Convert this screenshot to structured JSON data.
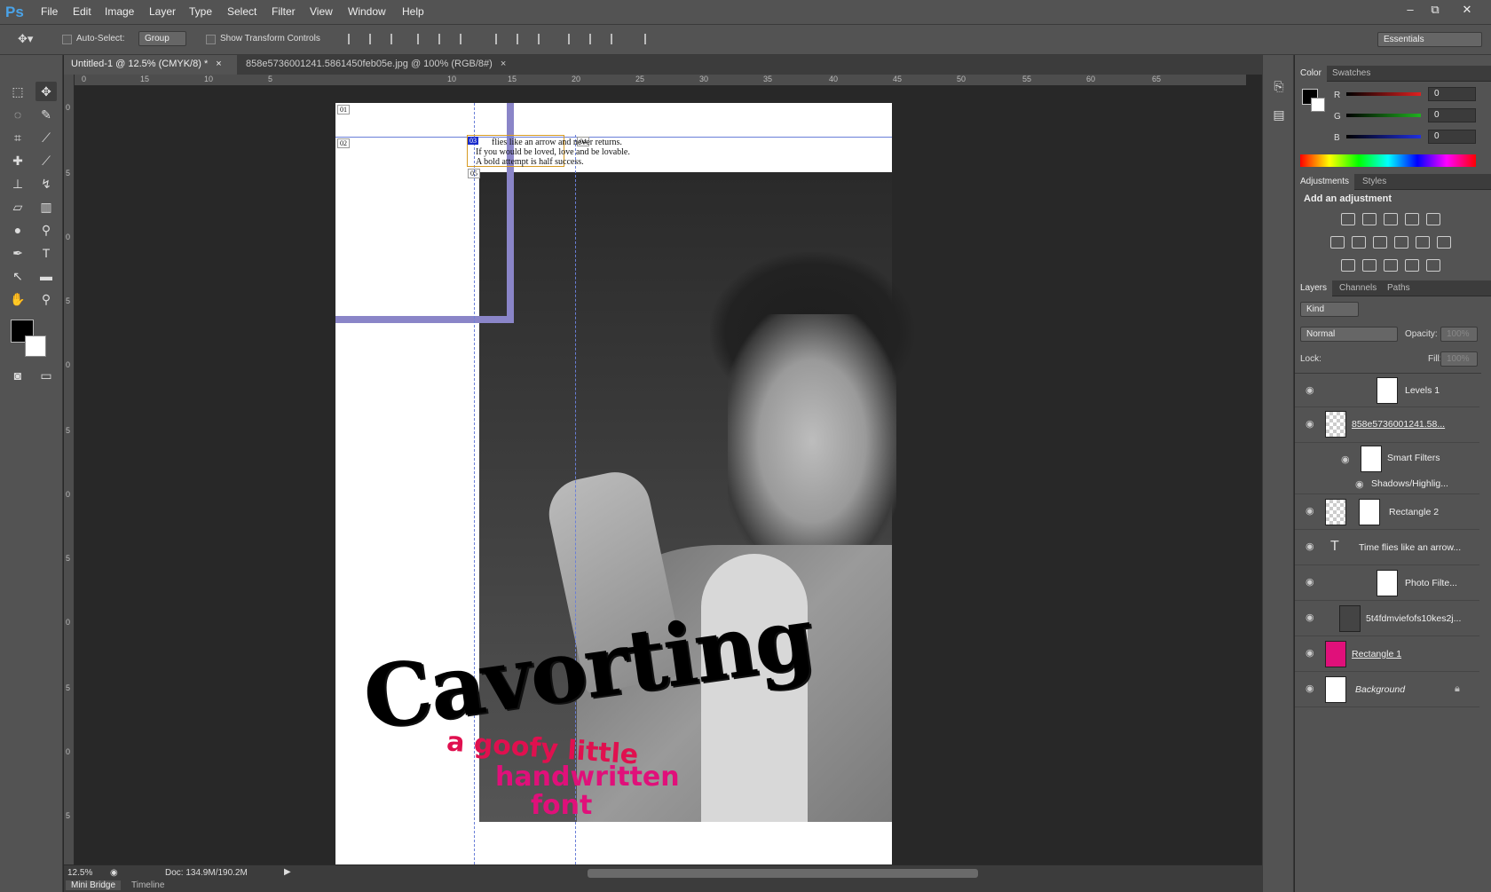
{
  "app": {
    "logo": "Ps"
  },
  "menu": [
    "File",
    "Edit",
    "Image",
    "Layer",
    "Type",
    "Select",
    "Filter",
    "View",
    "Window",
    "Help"
  ],
  "window_controls": [
    "–",
    "⧉",
    "✕"
  ],
  "options": {
    "auto_select_label": "Auto-Select:",
    "auto_select_value": "Group",
    "transform_label": "Show Transform Controls",
    "workspace": "Essentials"
  },
  "doc_tabs": [
    {
      "label": "Untitled-1 @ 12.5% (CMYK/8) *",
      "close": "×"
    },
    {
      "label": "858e5736001241.5861450feb05e.jpg @ 100% (RGB/8#)",
      "close": "×"
    }
  ],
  "ruler_h": [
    "0",
    "15",
    "10",
    "5",
    "10",
    "15",
    "20",
    "25",
    "30",
    "35",
    "40",
    "45",
    "50",
    "55",
    "60",
    "65"
  ],
  "ruler_v": [
    "0",
    "5",
    "0",
    "5",
    "0",
    "5",
    "0",
    "5",
    "0",
    "5",
    "0",
    "5",
    "0",
    "5",
    "0",
    "5"
  ],
  "canvas": {
    "slice_labels": [
      "01",
      "02",
      "03",
      "04",
      "05"
    ],
    "text_lines": [
      "flies like an arrow and never returns.",
      "If you would be loved, love and be lovable.",
      "A bold attempt is half success."
    ],
    "title_art": "Cavorting",
    "tagline": [
      "a goofy little",
      "handwritten",
      "font"
    ]
  },
  "status": {
    "zoom": "12.5%",
    "doc": "Doc: 134.9M/190.2M"
  },
  "bottom_tabs": [
    "Mini Bridge",
    "Timeline"
  ],
  "color_panel": {
    "tabs": [
      "Color",
      "Swatches"
    ],
    "channels": [
      {
        "name": "R",
        "value": "0",
        "color": "#e02020"
      },
      {
        "name": "G",
        "value": "0",
        "color": "#20b020"
      },
      {
        "name": "B",
        "value": "0",
        "color": "#2030e0"
      }
    ]
  },
  "adjust_panel": {
    "tabs": [
      "Adjustments",
      "Styles"
    ],
    "heading": "Add an adjustment"
  },
  "layers_panel": {
    "tabs": [
      "Layers",
      "Channels",
      "Paths"
    ],
    "kind": "Kind",
    "blend": "Normal",
    "opacity_label": "Opacity:",
    "opacity_value": "100%",
    "lock_label": "Lock:",
    "fill_label": "Fill:",
    "fill_value": "100%",
    "layers": [
      {
        "name": "Levels 1",
        "type": "adjust"
      },
      {
        "name": "858e5736001241.58...",
        "type": "smart"
      },
      {
        "name": "Smart Filters",
        "type": "filters"
      },
      {
        "name": "Shadows/Highlig...",
        "type": "filter"
      },
      {
        "name": "Rectangle 2",
        "type": "shape"
      },
      {
        "name": "Time flies like an arrow...",
        "type": "text"
      },
      {
        "name": "Photo Filte...",
        "type": "adjust"
      },
      {
        "name": "5t4fdmviefofs10kes2j...",
        "type": "image"
      },
      {
        "name": "Rectangle 1",
        "type": "shape-pink"
      },
      {
        "name": "Background",
        "type": "bg"
      }
    ]
  }
}
